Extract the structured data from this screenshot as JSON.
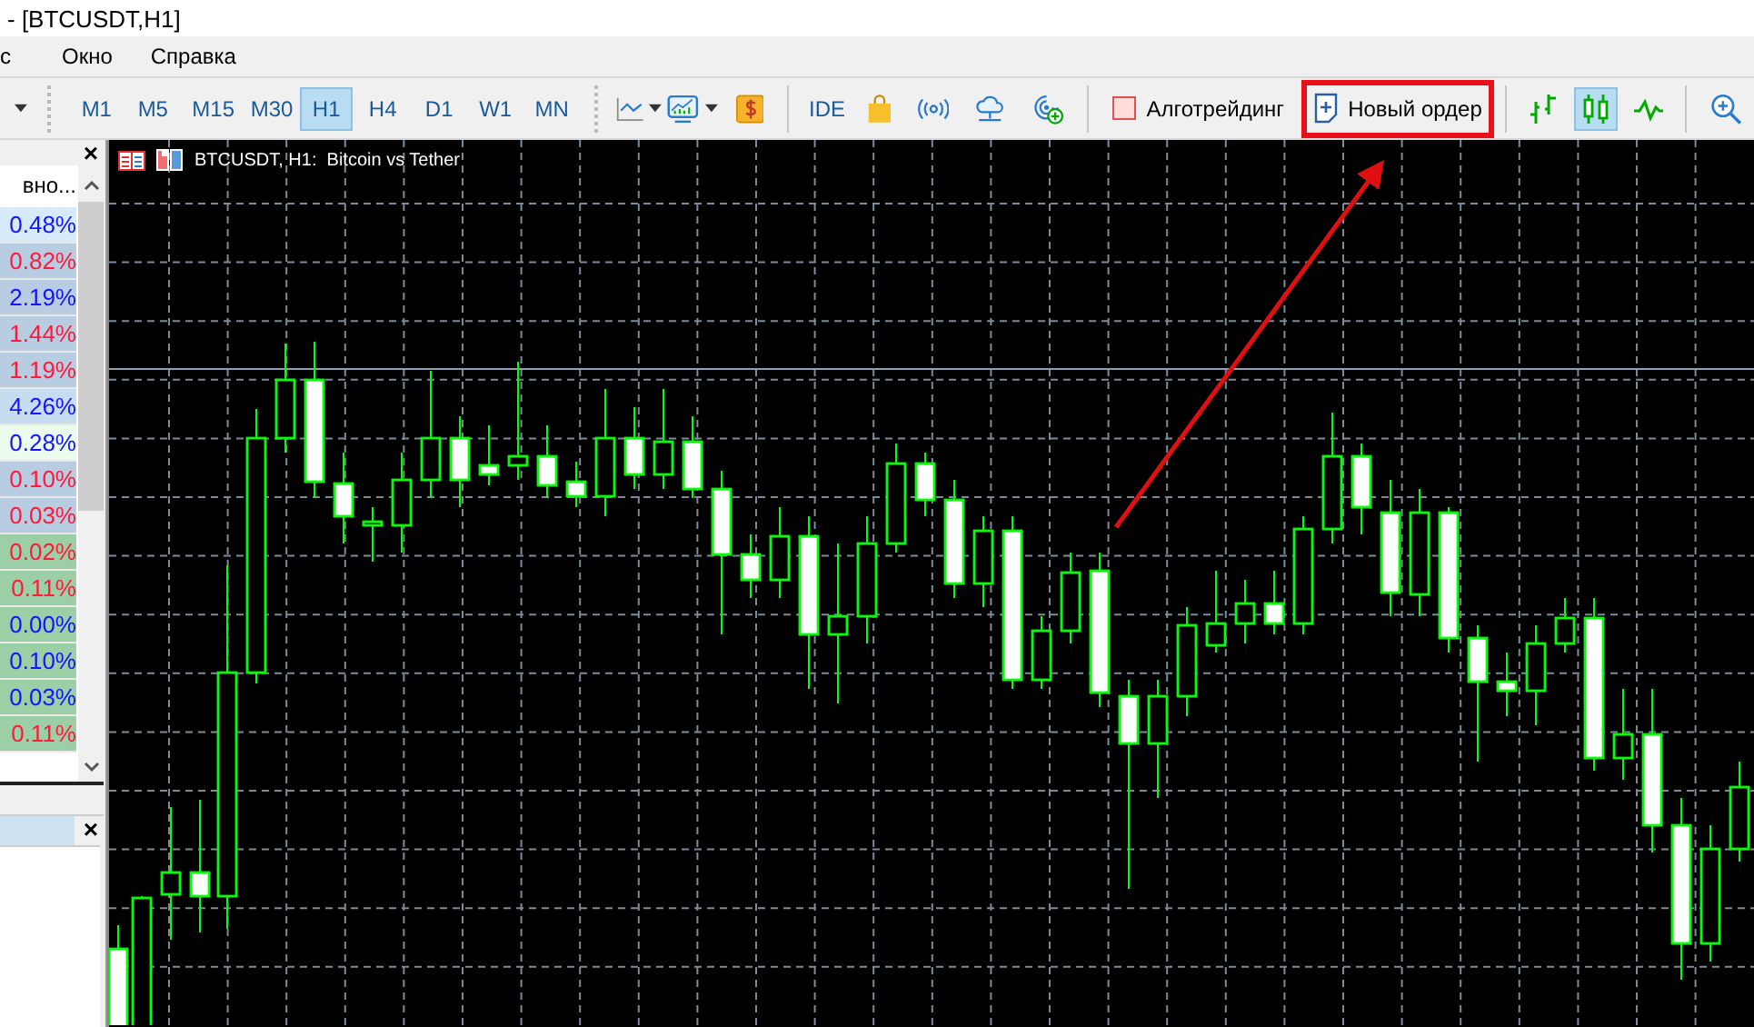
{
  "window": {
    "title": "- [BTCUSDT,H1]"
  },
  "menu": [
    {
      "label": "с"
    },
    {
      "label": "Окно"
    },
    {
      "label": "Справка"
    }
  ],
  "toolbar": {
    "timeframes": [
      {
        "label": "M1",
        "selected": false
      },
      {
        "label": "M5",
        "selected": false
      },
      {
        "label": "M15",
        "selected": false
      },
      {
        "label": "M30",
        "selected": false
      },
      {
        "label": "H1",
        "selected": true
      },
      {
        "label": "H4",
        "selected": false
      },
      {
        "label": "D1",
        "selected": false
      },
      {
        "label": "W1",
        "selected": false
      },
      {
        "label": "MN",
        "selected": false
      }
    ],
    "ide": "IDE",
    "algo": {
      "label": "Алготрейдинг",
      "on": false
    },
    "new_order": {
      "label": "Новый ордер",
      "highlighted": true
    },
    "chart_types": [
      {
        "kind": "bars",
        "selected": false
      },
      {
        "kind": "candles",
        "selected": true
      },
      {
        "kind": "line",
        "selected": false
      }
    ]
  },
  "market_watch": {
    "close": "×",
    "column": "вно...",
    "rows": [
      {
        "change": "0.48%",
        "color": "#1414ff",
        "kind": "selected"
      },
      {
        "change": "0.82%",
        "color": "#ff1a3c",
        "kind": "shaded"
      },
      {
        "change": "2.19%",
        "color": "#1414ff",
        "kind": "shaded"
      },
      {
        "change": "1.44%",
        "color": "#ff1a3c",
        "kind": "shaded"
      },
      {
        "change": "1.19%",
        "color": "#ff1a3c",
        "kind": "shaded"
      },
      {
        "change": "4.26%",
        "color": "#1414ff",
        "kind": "light"
      },
      {
        "change": "0.28%",
        "color": "#1414ff",
        "kind": "pale"
      },
      {
        "change": "0.10%",
        "color": "#ff1a3c",
        "kind": "shaded"
      },
      {
        "change": "0.03%",
        "color": "#ff1a3c",
        "kind": "shaded"
      },
      {
        "change": "0.02%",
        "color": "#ff1a3c",
        "kind": "green"
      },
      {
        "change": "0.11%",
        "color": "#ff1a3c",
        "kind": "green"
      },
      {
        "change": "0.00%",
        "color": "#1414ff",
        "kind": "green"
      },
      {
        "change": "0.10%",
        "color": "#1414ff",
        "kind": "green"
      },
      {
        "change": "0.03%",
        "color": "#1414ff",
        "kind": "green"
      },
      {
        "change": "0.11%",
        "color": "#ff1a3c",
        "kind": "green"
      }
    ]
  },
  "lower_panel": {
    "close": "×"
  },
  "chart": {
    "title": "BTCUSDT, H1:  Bitcoin vs Tether"
  }
}
